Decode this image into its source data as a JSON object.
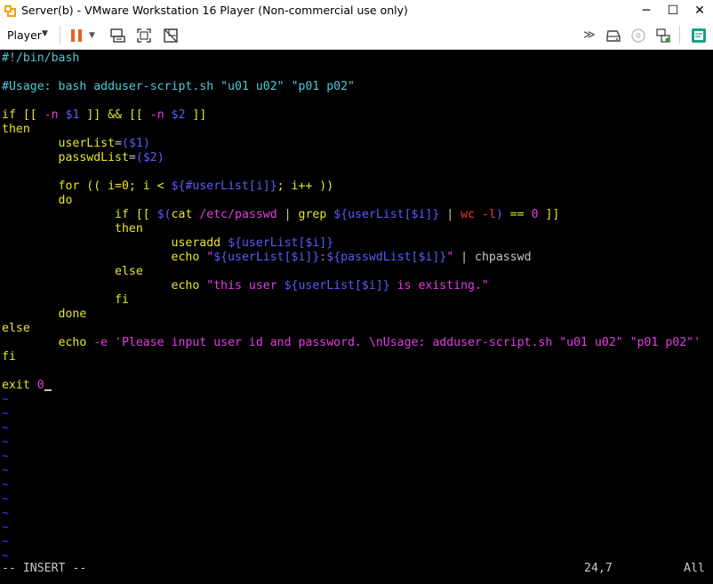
{
  "window": {
    "title": "Server(b) - VMware Workstation 16 Player (Non-commercial use only)"
  },
  "window_buttons": {
    "minimize": "─",
    "maximize": "☐",
    "close": "✕"
  },
  "toolbar": {
    "player_label": "Player",
    "icons": [
      "pause-icon",
      "send-ctrl-alt-del-icon",
      "fullscreen-icon",
      "unity-icon",
      "forward-icon",
      "hdd-icon",
      "cdrom-icon",
      "network-icon",
      "notes-icon"
    ]
  },
  "editor": {
    "lines": [
      [
        {
          "t": "#!/bin/bash",
          "c": "c-comment"
        }
      ],
      [],
      [
        {
          "t": "#Usage: bash adduser-script.sh \"u01 u02\" \"p01 p02\"",
          "c": "c-comment"
        }
      ],
      [],
      [
        {
          "t": "if",
          "c": "c-kw"
        },
        {
          "t": " [[ ",
          "c": "c-kw"
        },
        {
          "t": "-n",
          "c": "c-str"
        },
        {
          "t": " ",
          "c": "c-plain"
        },
        {
          "t": "$1",
          "c": "c-var"
        },
        {
          "t": " ]] && [[ ",
          "c": "c-kw"
        },
        {
          "t": "-n",
          "c": "c-str"
        },
        {
          "t": " ",
          "c": "c-plain"
        },
        {
          "t": "$2",
          "c": "c-var"
        },
        {
          "t": " ]]",
          "c": "c-kw"
        }
      ],
      [
        {
          "t": "then",
          "c": "c-kw"
        }
      ],
      [
        {
          "t": "        userList",
          "c": "c-kw"
        },
        {
          "t": "=",
          "c": "c-plain"
        },
        {
          "t": "($1)",
          "c": "c-var"
        }
      ],
      [
        {
          "t": "        passwdList",
          "c": "c-kw"
        },
        {
          "t": "=",
          "c": "c-plain"
        },
        {
          "t": "($2)",
          "c": "c-var"
        }
      ],
      [],
      [
        {
          "t": "        for",
          "c": "c-kw"
        },
        {
          "t": " (( i=0; i < ",
          "c": "c-kw"
        },
        {
          "t": "${#userList[i]}",
          "c": "c-var"
        },
        {
          "t": "; i++ ))",
          "c": "c-kw"
        }
      ],
      [
        {
          "t": "        do",
          "c": "c-kw"
        }
      ],
      [
        {
          "t": "                if",
          "c": "c-kw"
        },
        {
          "t": " [[ ",
          "c": "c-kw"
        },
        {
          "t": "$(",
          "c": "c-var"
        },
        {
          "t": "cat",
          "c": "c-kw"
        },
        {
          "t": " /etc/passwd ",
          "c": "c-str"
        },
        {
          "t": "|",
          "c": "c-plain"
        },
        {
          "t": " grep ",
          "c": "c-kw"
        },
        {
          "t": "${userList[$i]}",
          "c": "c-var"
        },
        {
          "t": " | ",
          "c": "c-plain"
        },
        {
          "t": "wc -l",
          "c": "c-red"
        },
        {
          "t": ")",
          "c": "c-var"
        },
        {
          "t": " == ",
          "c": "c-kw"
        },
        {
          "t": "0",
          "c": "c-str"
        },
        {
          "t": " ]]",
          "c": "c-kw"
        }
      ],
      [
        {
          "t": "                then",
          "c": "c-kw"
        }
      ],
      [
        {
          "t": "                        useradd ",
          "c": "c-kw"
        },
        {
          "t": "${userList[$i]}",
          "c": "c-var"
        }
      ],
      [
        {
          "t": "                        echo",
          "c": "c-kw"
        },
        {
          "t": " \"",
          "c": "c-str"
        },
        {
          "t": "${userList[$i]}",
          "c": "c-var"
        },
        {
          "t": ":",
          "c": "c-str"
        },
        {
          "t": "${passwdList[$i]}",
          "c": "c-var"
        },
        {
          "t": "\"",
          "c": "c-str"
        },
        {
          "t": " | chpasswd",
          "c": "c-plain"
        }
      ],
      [
        {
          "t": "                else",
          "c": "c-kw"
        }
      ],
      [
        {
          "t": "                        echo",
          "c": "c-kw"
        },
        {
          "t": " \"this user ",
          "c": "c-str"
        },
        {
          "t": "${userList[$i]}",
          "c": "c-var"
        },
        {
          "t": " is existing.\"",
          "c": "c-str"
        }
      ],
      [
        {
          "t": "                fi",
          "c": "c-kw"
        }
      ],
      [
        {
          "t": "        done",
          "c": "c-kw"
        }
      ],
      [
        {
          "t": "else",
          "c": "c-kw"
        }
      ],
      [
        {
          "t": "        echo",
          "c": "c-kw"
        },
        {
          "t": " -e ",
          "c": "c-str"
        },
        {
          "t": "'Please input user id and password. \\nUsage: adduser-script.sh \"u01 u02\" \"p01 p02\"'",
          "c": "c-str"
        }
      ],
      [
        {
          "t": "fi",
          "c": "c-kw"
        }
      ],
      [],
      [
        {
          "t": "exit",
          "c": "c-kw"
        },
        {
          "t": " 0",
          "c": "c-str"
        }
      ]
    ],
    "empty_line_marker": "~",
    "empty_line_count": 12
  },
  "statusline": {
    "mode": "-- INSERT --",
    "position": "24,7",
    "scroll": "All"
  }
}
